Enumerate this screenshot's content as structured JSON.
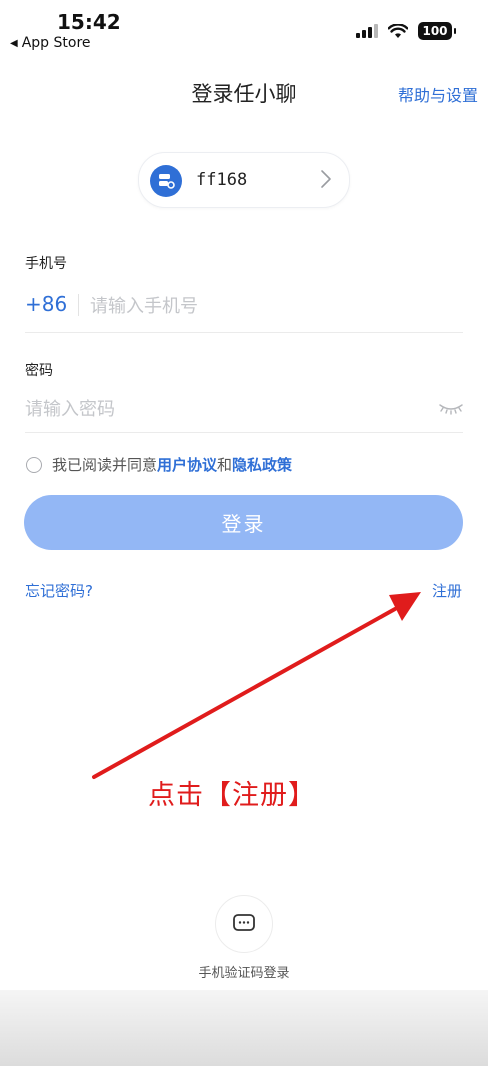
{
  "status_bar": {
    "time": "15:42",
    "back_app": "App Store",
    "battery": "100"
  },
  "header": {
    "title": "登录任小聊",
    "help_link": "帮助与设置"
  },
  "server": {
    "name": "ff168",
    "icon": "server-icon"
  },
  "form": {
    "phone_label": "手机号",
    "phone_prefix": "+86",
    "phone_placeholder": "请输入手机号",
    "password_label": "密码",
    "password_placeholder": "请输入密码"
  },
  "agreement": {
    "prefix": "我已阅读并同意",
    "user_agreement": "用户协议",
    "and": "和",
    "privacy_policy": "隐私政策"
  },
  "login_button": "登录",
  "links": {
    "forgot_password": "忘记密码?",
    "register": "注册"
  },
  "annotation": {
    "text": "点击【注册】",
    "color": "#e01c1c"
  },
  "sms_login": {
    "label": "手机验证码登录"
  },
  "colors": {
    "accent": "#2f6fd6",
    "button_disabled": "#93b7f5"
  }
}
